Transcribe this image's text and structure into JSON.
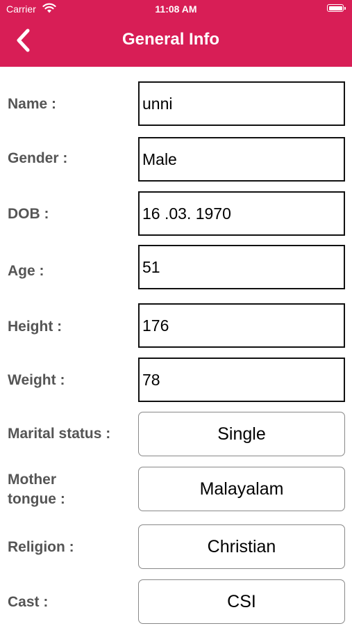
{
  "status_bar": {
    "carrier": "Carrier",
    "time": "11:08 AM",
    "battery_level": 1.0
  },
  "nav": {
    "title": "General Info",
    "back_icon": "chevron-left-icon"
  },
  "fields": {
    "name": {
      "label": "Name :",
      "value": "unni"
    },
    "gender": {
      "label": "Gender :",
      "value": "Male"
    },
    "dob": {
      "label": "DOB :",
      "value": "16 .03. 1970"
    },
    "age": {
      "label": "Age :",
      "value": "51"
    },
    "height": {
      "label": "Height :",
      "value": "176"
    },
    "weight": {
      "label": "Weight :",
      "value": "78"
    }
  },
  "selects": {
    "marital_status": {
      "label": "Marital status :",
      "value": "Single"
    },
    "mother_tongue": {
      "label_line1": "Mother",
      "label_line2": "tongue :",
      "value": "Malayalam"
    },
    "religion": {
      "label": "Religion :",
      "value": "Christian"
    },
    "cast": {
      "label": "Cast :",
      "value": "CSI"
    }
  },
  "colors": {
    "header": "#d81e56",
    "label": "#555555"
  }
}
